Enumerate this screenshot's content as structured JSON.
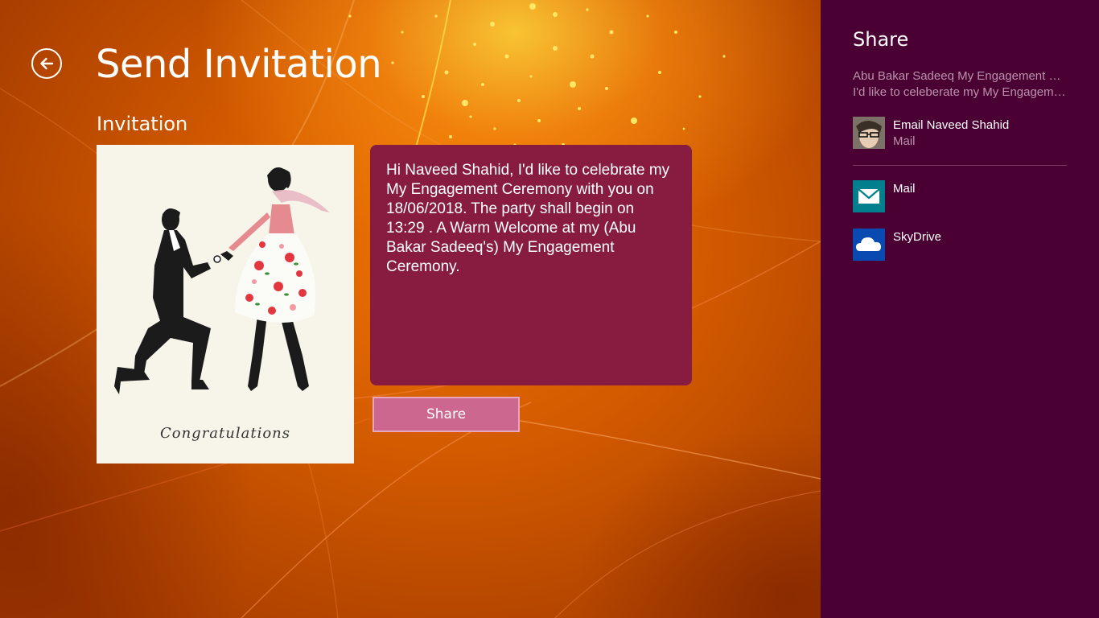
{
  "app": {
    "title": "Send Invitation",
    "section_title": "Invitation",
    "card_caption": "Congratulations",
    "message": "Hi Naveed Shahid, I'd like to celebrate my My Engagement Ceremony with you on 18/06/2018. The party shall begin on 13:29 . A Warm Welcome at my (Abu Bakar Sadeeq's) My Engagement Ceremony.",
    "share_button_label": "Share"
  },
  "charm": {
    "title": "Share",
    "description_line1": "Abu Bakar Sadeeq My Engagement Ceremony",
    "description_line2": "I'd like to celeberate my My Engagement Ceremony",
    "top_target": {
      "name": "Email Naveed Shahid",
      "app": "Mail",
      "icon": "contact-avatar"
    },
    "targets": [
      {
        "name": "Mail",
        "icon": "mail-icon",
        "color": "#00808f"
      },
      {
        "name": "SkyDrive",
        "icon": "skydrive-cloud-icon",
        "color": "#094ab2"
      }
    ]
  },
  "colors": {
    "charm_background": "#4b0033",
    "message_box": "#871c40",
    "share_button": "#cc678f",
    "secondary_text": "#b992ac"
  }
}
